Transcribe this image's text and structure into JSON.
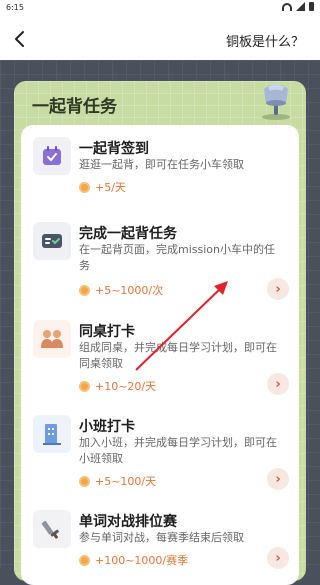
{
  "status_bar": {
    "time": "6:15"
  },
  "header": {
    "help_label": "铜板是什么？"
  },
  "panel": {
    "title": "一起背任务"
  },
  "tasks": [
    {
      "title": "一起背签到",
      "desc": "逛逛一起背，即可在任务小车领取",
      "reward": "+5/天",
      "has_action": false,
      "icon": "calendar-icon"
    },
    {
      "title": "完成一起背任务",
      "desc": "在一起背页面，完成mission小车中的任务",
      "reward": "+5~1000/次",
      "has_action": true,
      "icon": "task-card-icon"
    },
    {
      "title": "同桌打卡",
      "desc": "组成同桌，并完成每日学习计划，即可在同桌领取",
      "reward": "+10~20/天",
      "has_action": true,
      "icon": "deskmate-icon"
    },
    {
      "title": "小班打卡",
      "desc": "加入小班，并完成每日学习计划，即可在小班领取",
      "reward": "+5~100/天",
      "has_action": true,
      "icon": "class-building-icon"
    },
    {
      "title": "单词对战排位赛",
      "desc": "参与单词对战，每赛季结束后领取",
      "reward": "+100~1000/赛季",
      "has_action": true,
      "icon": "sword-icon"
    }
  ],
  "colors": {
    "panel": "#c7dca3",
    "reward_text": "#e0763a",
    "background": "#49525c",
    "annotation_arrow": "#e0232b"
  }
}
